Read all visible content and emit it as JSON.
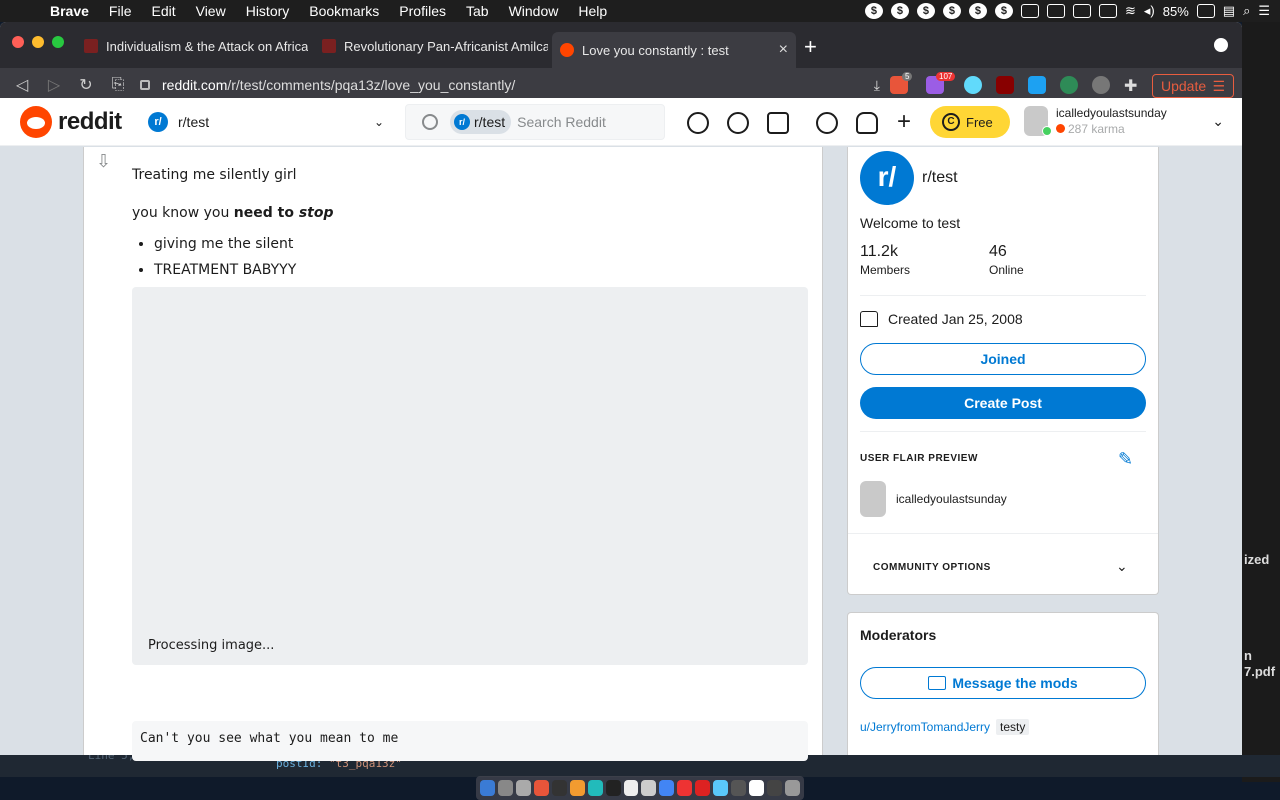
{
  "menubar": {
    "app": "Brave",
    "items": [
      "File",
      "Edit",
      "View",
      "History",
      "Bookmarks",
      "Profiles",
      "Tab",
      "Window",
      "Help"
    ],
    "battery": "85%"
  },
  "tabs": [
    {
      "title": "Individualism & the Attack on Africa"
    },
    {
      "title": "Revolutionary Pan-Africanist Amilca"
    },
    {
      "title": "Love you constantly : test",
      "close": "×"
    }
  ],
  "url": {
    "host": "reddit.com",
    "path": "/r/test/comments/pqa13z/love_you_constantly/"
  },
  "browser": {
    "update_label": "Update",
    "shields_badge": "5",
    "rewards_badge": "107"
  },
  "reddit_header": {
    "logo_text": "reddit",
    "community": "r/test",
    "search_chip": "r/test",
    "search_placeholder": "Search Reddit",
    "free_label": "Free",
    "username": "icalledyoulastsunday",
    "karma": "287 karma"
  },
  "post": {
    "line1": "Treating me silently girl",
    "line2_prefix": "you know you ",
    "line2_bold": "need to ",
    "line2_bold_italic": "stop",
    "bullets": [
      "giving me the silent",
      "TREATMENT BABYYY"
    ],
    "image_status": "Processing image...",
    "code": "Can't you see what you mean to me"
  },
  "sidebar": {
    "community_name": "r/test",
    "welcome": "Welcome to test",
    "members_count": "11.2k",
    "members_label": "Members",
    "online_count": "46",
    "online_label": "Online",
    "created": "Created Jan 25, 2008",
    "joined_label": "Joined",
    "create_post_label": "Create Post",
    "flair_title": "USER FLAIR PREVIEW",
    "flair_username": "icalledyoulastsunday",
    "community_options": "COMMUNITY OPTIONS"
  },
  "moderators": {
    "title": "Moderators",
    "message_label": "Message the mods",
    "mod1": "u/JerryfromTomandJerry",
    "mod1_flair": "testy"
  },
  "desktop": {
    "right_fragments": [
      "ized",
      "n",
      "7.pdf"
    ],
    "editor_status": "Line 5, Column 3",
    "code_key": "postId",
    "code_value": "\"t3_pqa13z\""
  }
}
